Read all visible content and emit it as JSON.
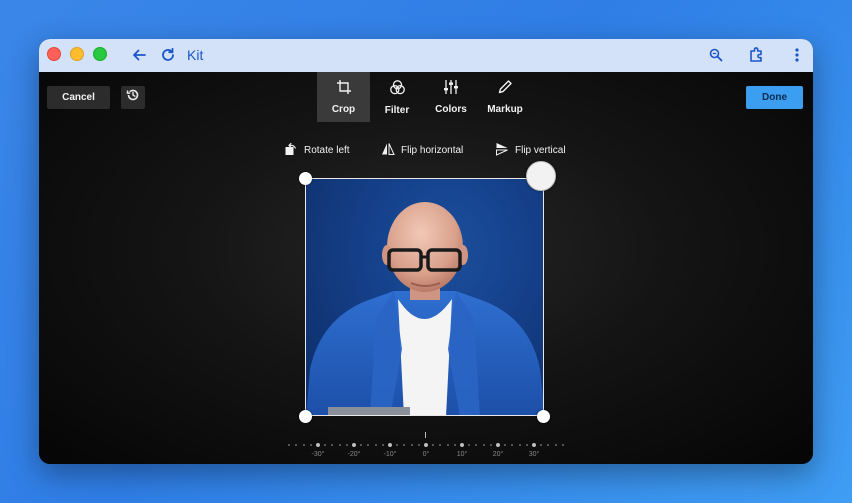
{
  "window": {
    "title": "Kit"
  },
  "toolbar": {
    "cancel_label": "Cancel",
    "done_label": "Done"
  },
  "tabs": [
    {
      "label": "Crop",
      "icon": "crop-icon",
      "active": true
    },
    {
      "label": "Filter",
      "icon": "filter-icon",
      "active": false
    },
    {
      "label": "Colors",
      "icon": "sliders-icon",
      "active": false
    },
    {
      "label": "Markup",
      "icon": "pen-icon",
      "active": false
    }
  ],
  "tools": {
    "rotate_left": "Rotate left",
    "flip_horizontal": "Flip horizontal",
    "flip_vertical": "Flip vertical"
  },
  "image": {
    "alt": "Portrait of bald man with glasses in blue jacket"
  },
  "ruler": {
    "labels": [
      "-30°",
      "-20°",
      "-10°",
      "0°",
      "10°",
      "20°",
      "30°"
    ],
    "current_angle": "0°"
  },
  "colors": {
    "accent": "#3b9ef0",
    "titlebar": "#d4e2f9",
    "background": "#000000"
  }
}
